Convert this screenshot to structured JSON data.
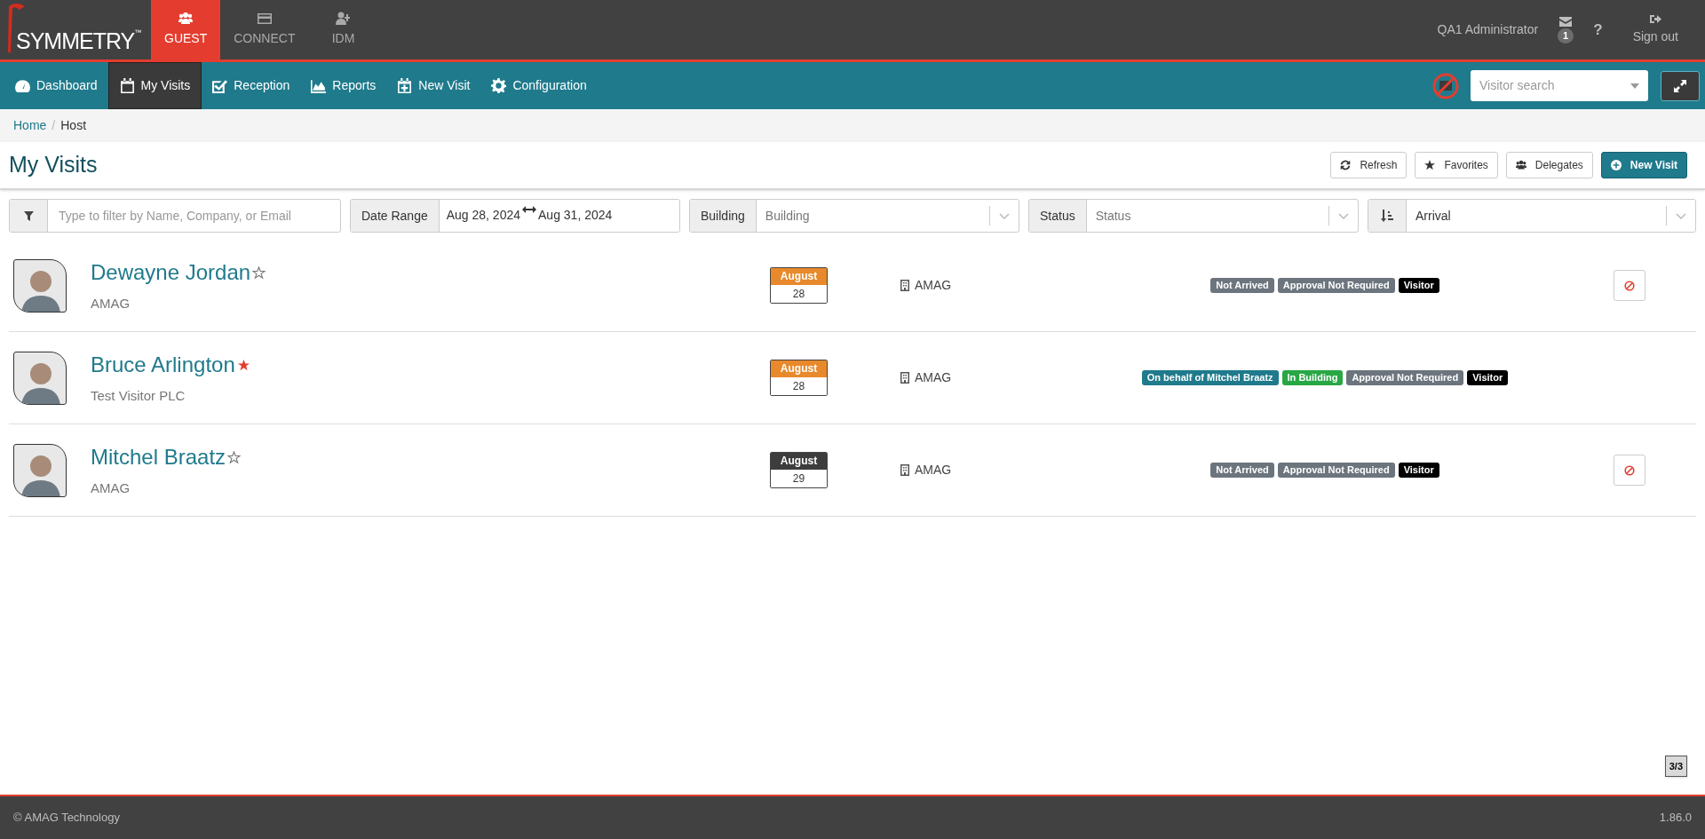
{
  "brand": {
    "name": "SYMMETRY",
    "mark": "™"
  },
  "modules": [
    {
      "label": "GUEST",
      "selected": true
    },
    {
      "label": "CONNECT",
      "selected": false
    },
    {
      "label": "IDM",
      "selected": false
    }
  ],
  "user": {
    "name": "QA1 Administrator",
    "messages": "1",
    "help": "?",
    "sign_out": "Sign out"
  },
  "nav": [
    {
      "label": "Dashboard",
      "selected": false
    },
    {
      "label": "My Visits",
      "selected": true
    },
    {
      "label": "Reception",
      "selected": false
    },
    {
      "label": "Reports",
      "selected": false
    },
    {
      "label": "New Visit",
      "selected": false
    },
    {
      "label": "Configuration",
      "selected": false
    }
  ],
  "visitor_search": {
    "placeholder": "Visitor search"
  },
  "breadcrumb": {
    "items": [
      "Home",
      "Host"
    ],
    "separator": "/"
  },
  "title": "My Visits",
  "actions": [
    {
      "label": "Refresh",
      "primary": false
    },
    {
      "label": "Favorites",
      "primary": false
    },
    {
      "label": "Delegates",
      "primary": false
    },
    {
      "label": "New Visit",
      "primary": true
    }
  ],
  "filters": {
    "search_placeholder": "Type to filter by Name, Company, or Email",
    "date_label": "Date Range",
    "date_from": "Aug 28, 2024",
    "date_to": "Aug 31, 2024",
    "building_label": "Building",
    "building_placeholder": "Building",
    "status_label": "Status",
    "status_placeholder": "Status",
    "sort_value": "Arrival"
  },
  "visits": [
    {
      "name": "Dewayne Jordan",
      "favorite": false,
      "company": "AMAG",
      "month": "August",
      "day": "28",
      "color": "#e8892b",
      "building": "AMAG",
      "tags": [
        {
          "label": "Not Arrived",
          "color": "#6c757d"
        },
        {
          "label": "Approval Not Required",
          "color": "#6c757d"
        },
        {
          "label": "Visitor",
          "color": "#000000"
        }
      ],
      "cancel_button": true
    },
    {
      "name": "Bruce Arlington",
      "favorite": true,
      "company": "Test Visitor PLC",
      "month": "August",
      "day": "28",
      "color": "#e8892b",
      "building": "AMAG",
      "tags": [
        {
          "label": "On behalf of Mitchel Braatz",
          "color": "#1f7a8c"
        },
        {
          "label": "In Building",
          "color": "#28a745"
        },
        {
          "label": "Approval Not Required",
          "color": "#6c757d"
        },
        {
          "label": "Visitor",
          "color": "#000000"
        }
      ],
      "cancel_button": false
    },
    {
      "name": "Mitchel Braatz",
      "favorite": false,
      "company": "AMAG",
      "month": "August",
      "day": "29",
      "color": "#3d3d3d",
      "building": "AMAG",
      "tags": [
        {
          "label": "Not Arrived",
          "color": "#6c757d"
        },
        {
          "label": "Approval Not Required",
          "color": "#6c757d"
        },
        {
          "label": "Visitor",
          "color": "#000000"
        }
      ],
      "cancel_button": true
    }
  ],
  "pager": "3/3",
  "footer": {
    "copyright": "© AMAG Technology",
    "version": "1.86.0"
  }
}
